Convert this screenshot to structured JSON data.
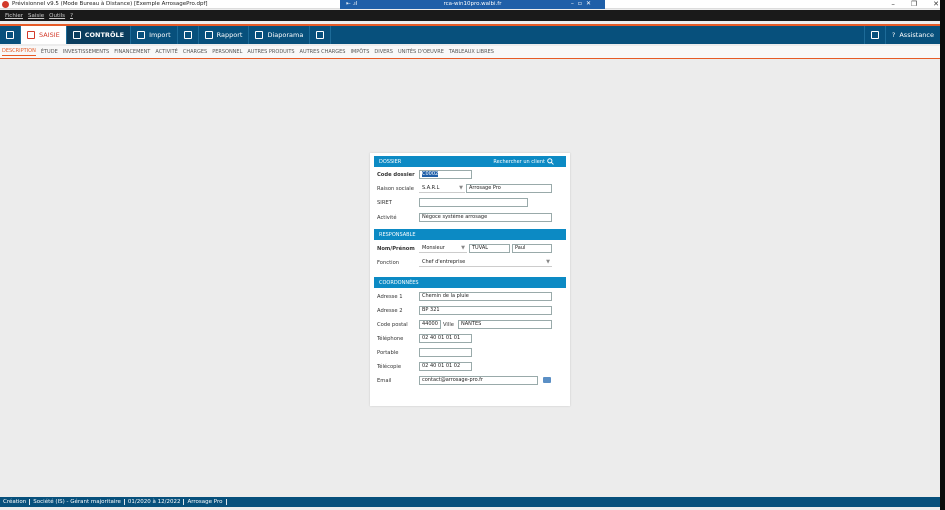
{
  "window": {
    "title": "Prévisionnel v9.5 (Mode Bureau à Distance) [Exemple ArrosagePro.dpf]",
    "remote_host": "rca-win10pro.walbi.fr",
    "remote_left": "⇤ .ıl",
    "remote_controls": "–▫✕",
    "controls": [
      "–",
      "❐",
      "✕"
    ]
  },
  "menu": [
    "Fichier",
    "Saisie",
    "Outils",
    "?"
  ],
  "toolbar": {
    "save_icon": "save-icon",
    "saisie": "SAISIE",
    "controle": "CONTRÔLE",
    "import": "Import",
    "rapport": "Rapport",
    "diaporama": "Diaporama",
    "assistance": "Assistance",
    "help_glyph": "?"
  },
  "tabs": [
    "DESCRIPTION",
    "ÉTUDE",
    "INVESTISSEMENTS",
    "FINANCEMENT",
    "ACTIVITÉ",
    "CHARGES",
    "PERSONNEL",
    "AUTRES PRODUITS",
    "AUTRES CHARGES",
    "IMPÔTS",
    "DIVERS",
    "UNITÉS D'OEUVRE",
    "TABLEAUX LIBRES"
  ],
  "form": {
    "dossier": {
      "header": "DOSSIER",
      "search_label": "Rechercher un client",
      "code_label": "Code dossier",
      "code_value": "C0002",
      "raison_label": "Raison sociale",
      "raison_type": "S.A.R.L",
      "raison_value": "Arrosage Pro",
      "siret_label": "SIRET",
      "siret_value": "",
      "activite_label": "Activité",
      "activite_value": "Négoce système arrosage"
    },
    "responsable": {
      "header": "RESPONSABLE",
      "nom_label": "Nom/Prénom",
      "civilite": "Monsieur",
      "nom": "TUVAL",
      "prenom": "Paul",
      "fonction_label": "Fonction",
      "fonction_value": "Chef d'entreprise"
    },
    "coordonnees": {
      "header": "COORDONNÉES",
      "adresse1_label": "Adresse 1",
      "adresse1": "Chemin de la pluie",
      "adresse2_label": "Adresse 2",
      "adresse2": "BP 321",
      "cp_label": "Code postal",
      "cp": "44000",
      "ville_label": "Ville",
      "ville": "NANTES",
      "tel_label": "Téléphone",
      "tel": "02 40 01 01 01",
      "portable_label": "Portable",
      "portable": "",
      "fax_label": "Télécopie",
      "fax": "02 40 01 01 02",
      "email_label": "Email",
      "email": "contact@arrosage-pro.fr"
    }
  },
  "status": [
    "Création",
    "Société (IS) - Gérant majoritaire",
    "01/2020 à 12/2022",
    "Arrosage Pro"
  ]
}
